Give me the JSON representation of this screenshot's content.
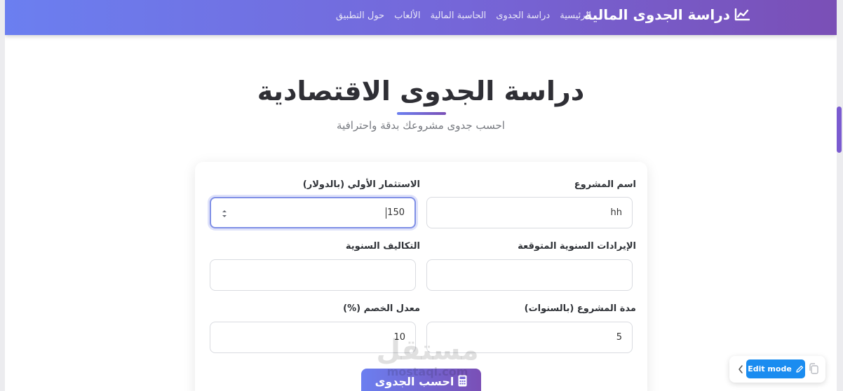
{
  "navbar": {
    "brand": "دراسة الجدوى المالية",
    "brand_icon": "chart-line-icon",
    "links": [
      "الرئيسية",
      "دراسة الجدوى",
      "الحاسبة المالية",
      "الألعاب",
      "حول التطبيق"
    ]
  },
  "hero": {
    "title": "دراسة الجدوى الاقتصادية",
    "subtitle": "احسب جدوى مشروعك بدقة واحترافية"
  },
  "form": {
    "project_name": {
      "label": "اسم المشروع",
      "value": "hh"
    },
    "initial_investment": {
      "label": "الاستثمار الأولي (بالدولار)",
      "value": "150"
    },
    "annual_revenue": {
      "label": "الإيرادات السنوية المتوقعة",
      "value": ""
    },
    "annual_costs": {
      "label": "التكاليف السنوية",
      "value": ""
    },
    "project_duration": {
      "label": "مدة المشروع (بالسنوات)",
      "value": "5"
    },
    "discount_rate": {
      "label": "معدل الخصم (%)",
      "value": "10"
    },
    "calculate_button": "احسب الجدوى",
    "calculate_icon": "calculator-icon"
  },
  "watermark": {
    "arabic": "مستقل",
    "latin": "mostaql.com"
  },
  "edit_widget": {
    "label": "Edit mode",
    "icon": "pencil-icon"
  },
  "colors": {
    "gradient_start": "#6b7ff0",
    "gradient_end": "#7a4fb6",
    "edit_button": "#1a8cf0",
    "focus_border": "#7f8fe6"
  }
}
